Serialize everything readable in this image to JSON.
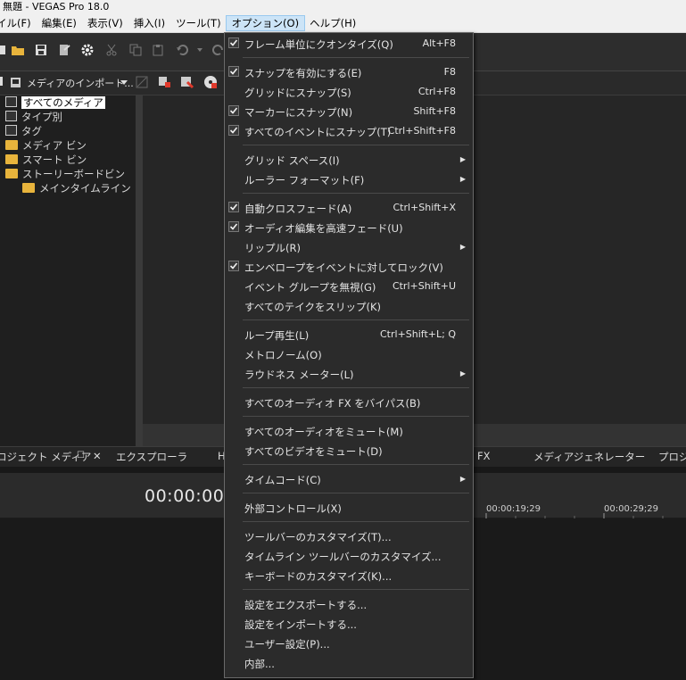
{
  "title": "無題 - VEGAS Pro 18.0",
  "menubar": [
    "イル(F)",
    "編集(E)",
    "表示(V)",
    "挿入(I)",
    "ツール(T)",
    "オプション(O)",
    "ヘルプ(H)"
  ],
  "media_bar": {
    "label": "メディアのインポート..."
  },
  "tree": [
    {
      "label": "すべてのメディア",
      "icon": "media-icon",
      "selected": true
    },
    {
      "label": "タイプ別",
      "icon": "media-icon"
    },
    {
      "label": "タグ",
      "icon": "media-icon"
    },
    {
      "label": "メディア ビン",
      "icon": "folder-icon"
    },
    {
      "label": "スマート ビン",
      "icon": "folder-icon"
    },
    {
      "label": "ストーリーボードビン",
      "icon": "folder-icon"
    },
    {
      "label": "メインタイムライン",
      "icon": "folder-icon"
    }
  ],
  "tabs": {
    "project_media": "ロジェクト メディア",
    "explorer": "エクスプローラ",
    "h": "H",
    "fx": "FX",
    "media_generator": "メディアジェネレーター",
    "project": "プロジ"
  },
  "timeline": {
    "timecode": "00:00:00;",
    "ruler": [
      "00:00:19;29",
      "00:00:29;29"
    ]
  },
  "options_menu": [
    {
      "label": "フレーム単位にクオンタイズ(Q)",
      "shortcut": "Alt+F8",
      "checked": true
    },
    {
      "sep": true
    },
    {
      "label": "スナップを有効にする(E)",
      "shortcut": "F8",
      "checked": true
    },
    {
      "label": "グリッドにスナップ(S)",
      "shortcut": "Ctrl+F8",
      "checked": false
    },
    {
      "label": "マーカーにスナップ(N)",
      "shortcut": "Shift+F8",
      "checked": true
    },
    {
      "label": "すべてのイベントにスナップ(T)",
      "shortcut": "Ctrl+Shift+F8",
      "checked": true
    },
    {
      "sep": true
    },
    {
      "label": "グリッド スペース(I)",
      "shortcut": "",
      "submenu": true
    },
    {
      "label": "ルーラー フォーマット(F)",
      "shortcut": "",
      "submenu": true
    },
    {
      "sep": true
    },
    {
      "label": "自動クロスフェード(A)",
      "shortcut": "Ctrl+Shift+X",
      "checked": true
    },
    {
      "label": "オーディオ編集を高速フェード(U)",
      "shortcut": "",
      "checked": true
    },
    {
      "label": "リップル(R)",
      "shortcut": "",
      "submenu": true
    },
    {
      "label": "エンベロープをイベントに対してロック(V)",
      "shortcut": "",
      "checked": true
    },
    {
      "label": "イベント グループを無視(G)",
      "shortcut": "Ctrl+Shift+U"
    },
    {
      "label": "すべてのテイクをスリップ(K)",
      "shortcut": ""
    },
    {
      "sep": true
    },
    {
      "label": "ループ再生(L)",
      "shortcut": "Ctrl+Shift+L; Q"
    },
    {
      "label": "メトロノーム(O)",
      "shortcut": ""
    },
    {
      "label": "ラウドネス メーター(L)",
      "shortcut": "",
      "submenu": true
    },
    {
      "sep": true
    },
    {
      "label": "すべてのオーディオ FX をバイパス(B)",
      "shortcut": ""
    },
    {
      "sep": true
    },
    {
      "label": "すべてのオーディオをミュート(M)",
      "shortcut": ""
    },
    {
      "label": "すべてのビデオをミュート(D)",
      "shortcut": ""
    },
    {
      "sep": true
    },
    {
      "label": "タイムコード(C)",
      "shortcut": "",
      "submenu": true
    },
    {
      "sep": true
    },
    {
      "label": "外部コントロール(X)",
      "shortcut": ""
    },
    {
      "sep": true
    },
    {
      "label": "ツールバーのカスタマイズ(T)...",
      "shortcut": ""
    },
    {
      "label": "タイムライン ツールバーのカスタマイズ...",
      "shortcut": ""
    },
    {
      "label": "キーボードのカスタマイズ(K)...",
      "shortcut": ""
    },
    {
      "sep": true
    },
    {
      "label": "設定をエクスポートする...",
      "shortcut": ""
    },
    {
      "label": "設定をインポートする...",
      "shortcut": ""
    },
    {
      "label": "ユーザー設定(P)...",
      "shortcut": ""
    },
    {
      "label": "内部...",
      "shortcut": ""
    }
  ]
}
